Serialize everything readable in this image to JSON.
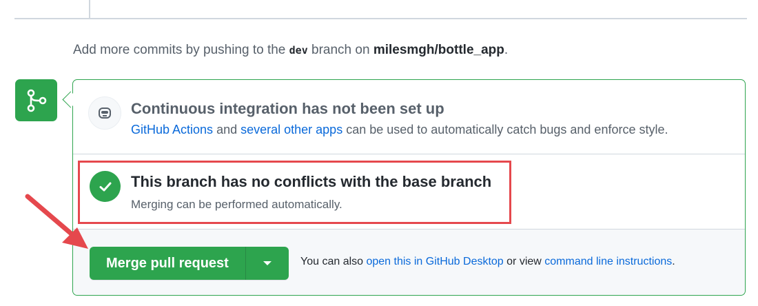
{
  "hint": {
    "prefix": "Add more commits by pushing to the ",
    "branch": "dev",
    "middle": " branch on ",
    "repo": "milesmgh/bottle_app",
    "suffix": "."
  },
  "ci": {
    "title": "Continuous integration has not been set up",
    "link1": "GitHub Actions",
    "and": " and ",
    "link2": "several other apps",
    "rest": " can be used to automatically catch bugs and enforce style."
  },
  "conflicts": {
    "title": "This branch has no conflicts with the base branch",
    "desc": "Merging can be performed automatically."
  },
  "merge": {
    "button_label": "Merge pull request",
    "also_prefix": "You can also ",
    "desktop_link": "open this in GitHub Desktop",
    "or_view": " or view ",
    "cli_link": "command line instructions",
    "suffix": "."
  },
  "colors": {
    "accent_green": "#2da44e",
    "annotation_red": "#e5484d",
    "link_blue": "#0969da"
  },
  "icons": {
    "badge": "git-merge-icon",
    "ci": "robot-icon",
    "status": "check-icon",
    "dropdown": "triangle-down-icon",
    "annotation": "red-arrow"
  }
}
